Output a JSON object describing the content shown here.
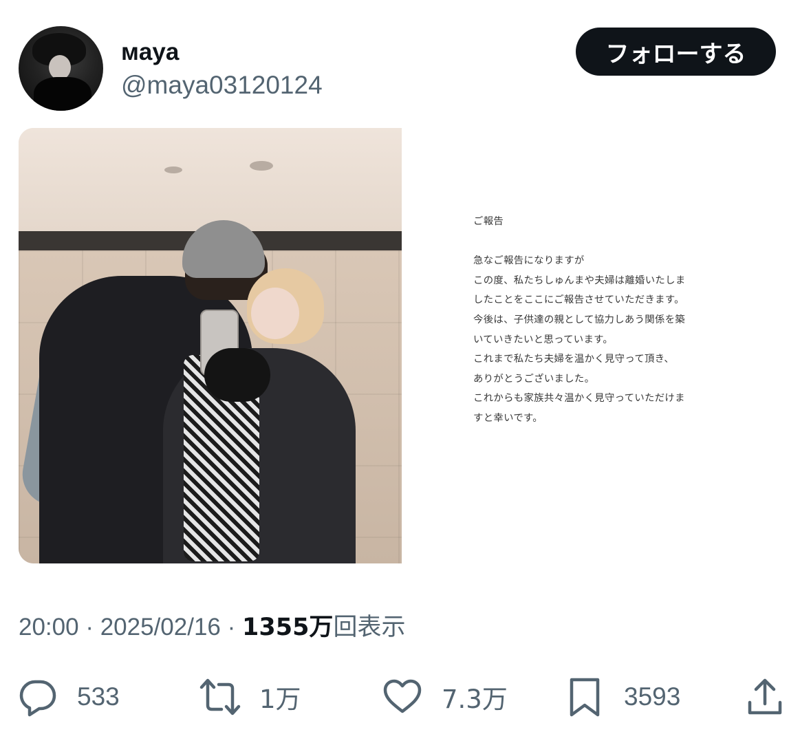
{
  "user": {
    "display_name": "мaya",
    "handle": "@maya03120124"
  },
  "follow_button": {
    "label": "フォローする"
  },
  "statement": {
    "text": "ご報告\n\n急なご報告になりますが\nこの度、私たちしゅんまや夫婦は離婚いたしま\nしたことをここにご報告させていただきます。\n今後は、子供達の親として協力しあう関係を築\nいていきたいと思っています。\nこれまで私たち夫婦を温かく見守って頂き、\nありがとうございました。\nこれからも家族共々温かく見守っていただけま\nすと幸いです。"
  },
  "meta": {
    "time": "20:00",
    "sep1": "·",
    "date": "2025/02/16",
    "sep2": "·",
    "views_count": "1355万",
    "views_suffix": "回表示"
  },
  "actions": {
    "reply_count": "533",
    "repost_count": "1万",
    "like_count": "7.3万",
    "bookmark_count": "3593"
  },
  "icons": [
    "reply-icon",
    "repost-icon",
    "like-icon",
    "bookmark-icon",
    "share-icon"
  ],
  "colors": {
    "text_primary": "#0f1419",
    "text_secondary": "#536471",
    "button_bg": "#0f1419",
    "button_text": "#ffffff"
  }
}
